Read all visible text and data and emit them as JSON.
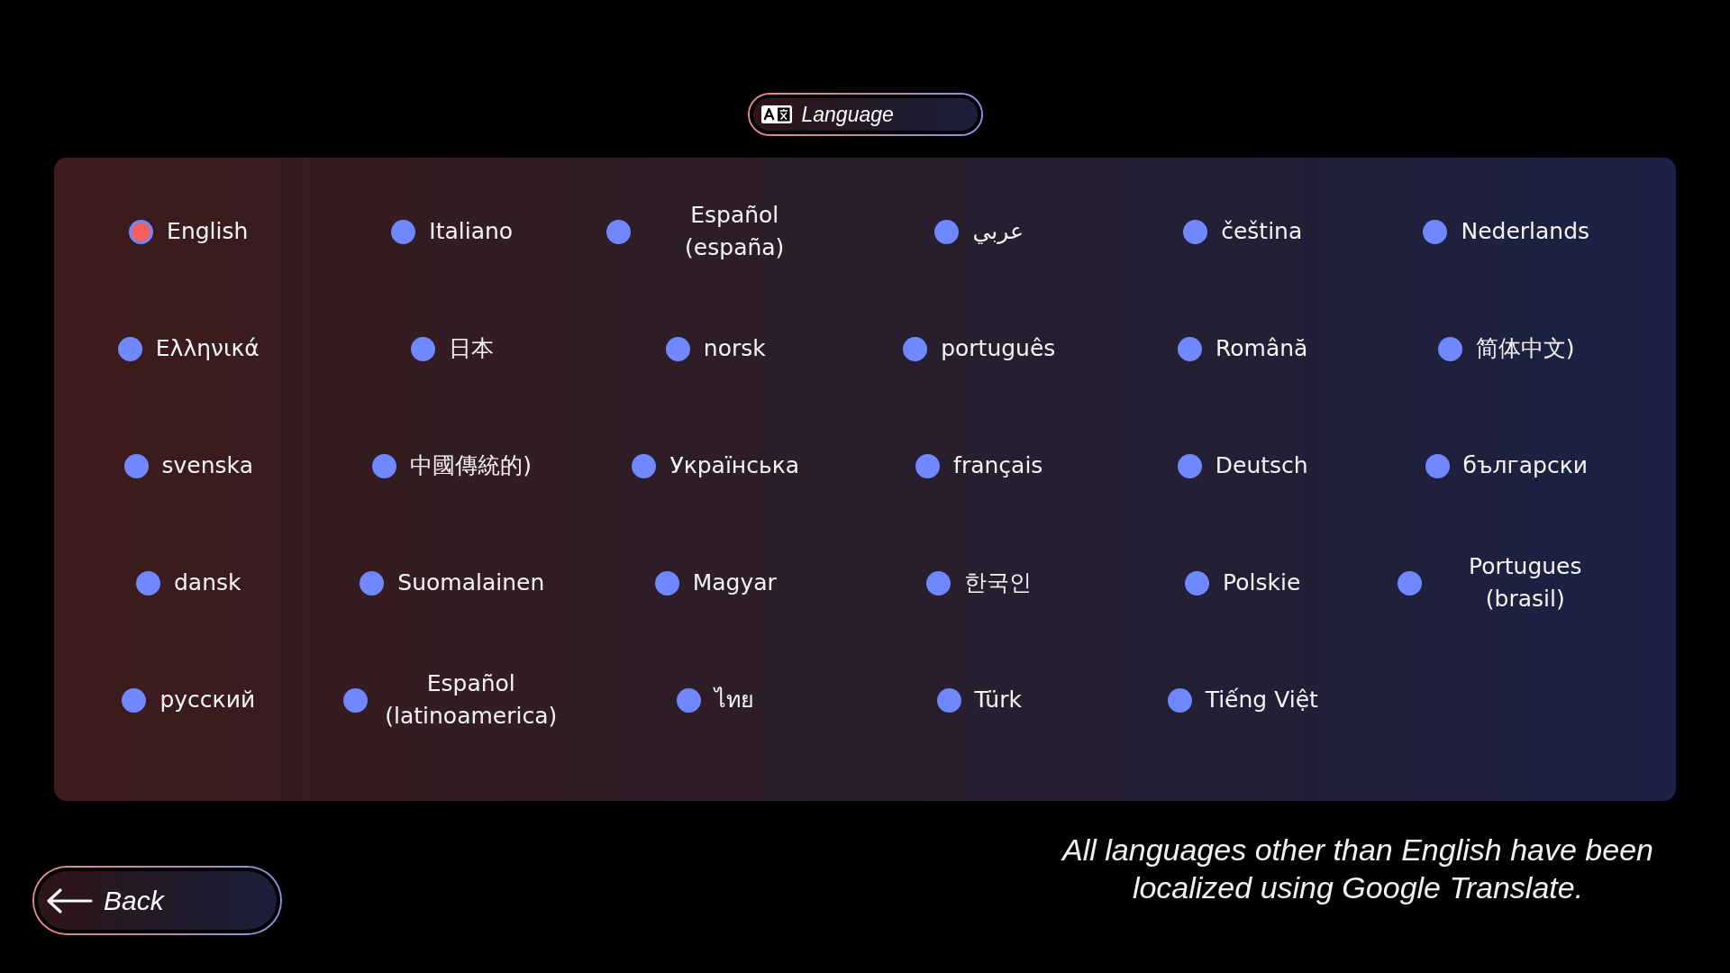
{
  "header": {
    "title": "Language"
  },
  "languages": [
    {
      "label": "English",
      "selected": true
    },
    {
      "label": "Italiano",
      "selected": false
    },
    {
      "label": "Español (españa)",
      "selected": false
    },
    {
      "label": "عربي",
      "selected": false
    },
    {
      "label": "čeština",
      "selected": false
    },
    {
      "label": "Nederlands",
      "selected": false
    },
    {
      "label": "Ελληνικά",
      "selected": false
    },
    {
      "label": "日本",
      "selected": false
    },
    {
      "label": "norsk",
      "selected": false
    },
    {
      "label": "português",
      "selected": false
    },
    {
      "label": "Română",
      "selected": false
    },
    {
      "label": "简体中文)",
      "selected": false
    },
    {
      "label": "svenska",
      "selected": false
    },
    {
      "label": "中國傳統的)",
      "selected": false
    },
    {
      "label": "Українська",
      "selected": false
    },
    {
      "label": "français",
      "selected": false
    },
    {
      "label": "Deutsch",
      "selected": false
    },
    {
      "label": "български",
      "selected": false
    },
    {
      "label": "dansk",
      "selected": false
    },
    {
      "label": "Suomalainen",
      "selected": false
    },
    {
      "label": "Magyar",
      "selected": false
    },
    {
      "label": "한국인",
      "selected": false
    },
    {
      "label": "Polskie",
      "selected": false
    },
    {
      "label": "Portugues (brasil)",
      "selected": false
    },
    {
      "label": "русский",
      "selected": false
    },
    {
      "label": "Español (latinoamerica)",
      "selected": false
    },
    {
      "label": "ไทย",
      "selected": false
    },
    {
      "label": "Türk",
      "selected": false
    },
    {
      "label": "Tiếng Việt",
      "selected": false
    }
  ],
  "back_button": {
    "label": "Back"
  },
  "note": "All languages other than English have been localized using Google Translate."
}
